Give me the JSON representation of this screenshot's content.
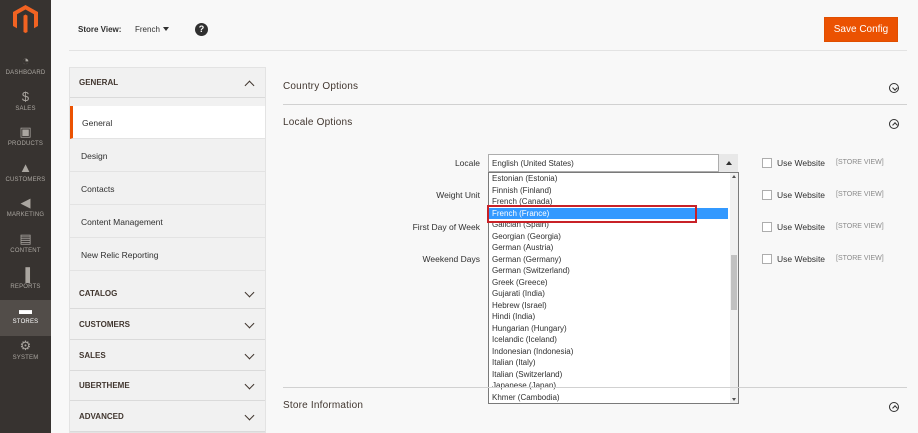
{
  "admin_nav": {
    "items": [
      {
        "label": "DASHBOARD",
        "icon": "dashboard-icon"
      },
      {
        "label": "SALES",
        "icon": "dollar-icon"
      },
      {
        "label": "PRODUCTS",
        "icon": "cube-icon"
      },
      {
        "label": "CUSTOMERS",
        "icon": "person-icon"
      },
      {
        "label": "MARKETING",
        "icon": "megaphone-icon"
      },
      {
        "label": "CONTENT",
        "icon": "content-icon"
      },
      {
        "label": "REPORTS",
        "icon": "bar-chart-icon"
      },
      {
        "label": "STORES",
        "icon": "store-icon"
      },
      {
        "label": "SYSTEM",
        "icon": "gear-icon"
      }
    ],
    "active": "STORES"
  },
  "topbar": {
    "store_view_label": "Store View:",
    "store_view_value": "French",
    "help": "?",
    "save_label": "Save Config"
  },
  "tabs": {
    "general": "GENERAL",
    "general_items": [
      "General",
      "Design",
      "Contacts",
      "Content Management",
      "New Relic Reporting"
    ],
    "catalog": "CATALOG",
    "customers": "CUSTOMERS",
    "sales": "SALES",
    "ubertheme": "UBERTHEME",
    "advanced": "ADVANCED"
  },
  "sections": {
    "country_options": "Country Options",
    "locale_options": "Locale Options",
    "store_information": "Store Information"
  },
  "fields": {
    "locale": "Locale",
    "weight_unit": "Weight Unit",
    "first_day_of_week": "First Day of Week",
    "weekend_days": "Weekend Days",
    "locale_value": "English (United States)",
    "use_website": "Use Website",
    "scope": "[STORE VIEW]"
  },
  "locale_options": [
    "Estonian (Estonia)",
    "Finnish (Finland)",
    "French (Canada)",
    "French (France)",
    "Galician (Spain)",
    "Georgian (Georgia)",
    "German (Austria)",
    "German (Germany)",
    "German (Switzerland)",
    "Greek (Greece)",
    "Gujarati (India)",
    "Hebrew (Israel)",
    "Hindi (India)",
    "Hungarian (Hungary)",
    "Icelandic (Iceland)",
    "Indonesian (Indonesia)",
    "Italian (Italy)",
    "Italian (Switzerland)",
    "Japanese (Japan)",
    "Khmer (Cambodia)"
  ],
  "highlighted_option": "French (France)",
  "colors": {
    "accent": "#eb5202",
    "nav_bg": "#373330",
    "selection": "#3399ff",
    "callout": "#c82127"
  }
}
